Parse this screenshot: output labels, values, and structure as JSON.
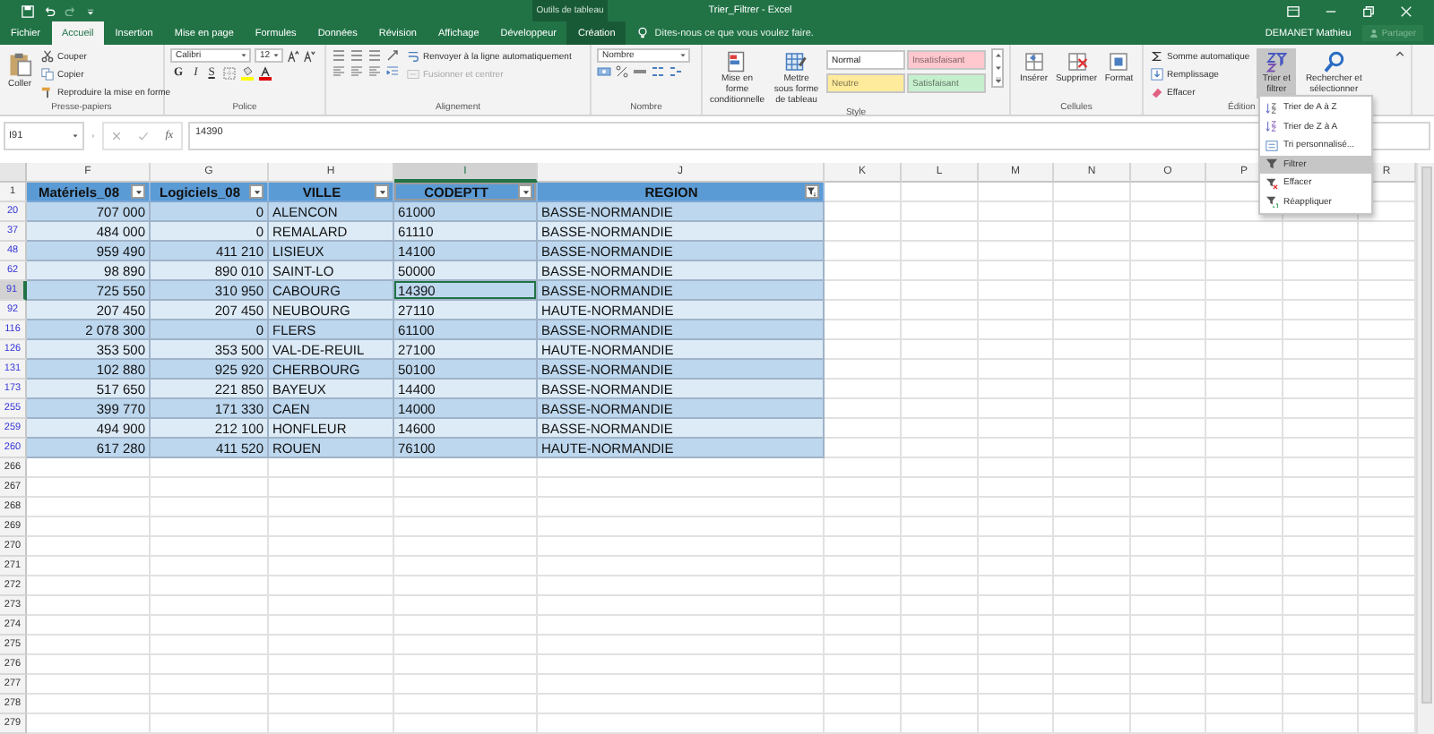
{
  "title_bar": {
    "context_label": "Outils de tableau",
    "title": "Trier_Filtrer - Excel"
  },
  "tabs": [
    {
      "label": "Fichier",
      "selected": false,
      "kind": "file"
    },
    {
      "label": "Accueil",
      "selected": true,
      "kind": "normal"
    },
    {
      "label": "Insertion",
      "selected": false,
      "kind": "normal"
    },
    {
      "label": "Mise en page",
      "selected": false,
      "kind": "normal"
    },
    {
      "label": "Formules",
      "selected": false,
      "kind": "normal"
    },
    {
      "label": "Données",
      "selected": false,
      "kind": "normal"
    },
    {
      "label": "Révision",
      "selected": false,
      "kind": "normal"
    },
    {
      "label": "Affichage",
      "selected": false,
      "kind": "normal"
    },
    {
      "label": "Développeur",
      "selected": false,
      "kind": "normal"
    },
    {
      "label": "Création",
      "selected": false,
      "kind": "context"
    }
  ],
  "tell_me": "Dites-nous ce que vous voulez faire.",
  "user": "DEMANET Mathieu",
  "share": "Partager",
  "ribbon": [
    {
      "kind": "clipboard",
      "label": "Presse-papiers",
      "big": "Coller",
      "items": [
        "Couper",
        "Copier",
        "Reproduire la mise en forme"
      ]
    },
    {
      "kind": "font",
      "label": "Police",
      "font": "Calibri",
      "size": "12",
      "styles": [
        "G",
        "I",
        "S"
      ]
    },
    {
      "kind": "alignment",
      "label": "Alignement",
      "items": [
        {
          "label": "Renvoyer à la ligne automatiquement",
          "disabled": false
        },
        {
          "label": "Fusionner et centrer",
          "disabled": true
        }
      ]
    },
    {
      "kind": "number",
      "label": "Nombre",
      "format": "Nombre"
    },
    {
      "kind": "styles",
      "label": "Style",
      "buttons": [
        "Mise en forme conditionnelle",
        "Mettre sous forme de tableau"
      ],
      "cell_styles": [
        {
          "label": "Normal",
          "color": "#ffffff"
        },
        {
          "label": "Insatisfaisant",
          "color": "#ffc7ce"
        },
        {
          "label": "Neutre",
          "color": "#ffeb9c"
        },
        {
          "label": "Satisfaisant",
          "color": "#c6efce"
        }
      ]
    },
    {
      "kind": "cells",
      "label": "Cellules",
      "buttons": [
        "Insérer",
        "Supprimer",
        "Format"
      ]
    },
    {
      "kind": "editing",
      "label": "Édition",
      "items": [
        "Somme automatique",
        "Remplissage",
        "Effacer"
      ],
      "buttons": [
        {
          "label": "Trier et filtrer",
          "selected": true
        },
        {
          "label": "Rechercher et sélectionner",
          "selected": false
        }
      ]
    }
  ],
  "formula_bar": {
    "name_box": "I91",
    "function_label": "fx",
    "value": "14390"
  },
  "sheet": {
    "columns": [
      {
        "letter": "F",
        "selected": false
      },
      {
        "letter": "G",
        "selected": false
      },
      {
        "letter": "H",
        "selected": false
      },
      {
        "letter": "I",
        "selected": true
      },
      {
        "letter": "J",
        "selected": false
      },
      {
        "letter": "K",
        "selected": false
      },
      {
        "letter": "L",
        "selected": false
      },
      {
        "letter": "M",
        "selected": false
      },
      {
        "letter": "N",
        "selected": false
      },
      {
        "letter": "O",
        "selected": false
      },
      {
        "letter": "P",
        "selected": false
      },
      {
        "letter": "R",
        "selected": false
      }
    ],
    "header_row": "1",
    "headers": [
      {
        "label": "Matériels_08",
        "kind": "number",
        "filtered": false
      },
      {
        "label": "Logiciels_08",
        "kind": "number",
        "filtered": false
      },
      {
        "label": "VILLE",
        "kind": "text",
        "filtered": false
      },
      {
        "label": "CODEPTT",
        "kind": "text",
        "filtered": false
      },
      {
        "label": "REGION",
        "kind": "text",
        "filtered": true
      }
    ],
    "rows": [
      {
        "number": "20",
        "filtered": true,
        "selected": false,
        "cells": [
          "707 000",
          "0",
          "ALENCON",
          "61000",
          "BASSE-NORMANDIE"
        ]
      },
      {
        "number": "37",
        "filtered": true,
        "selected": false,
        "cells": [
          "484 000",
          "0",
          "REMALARD",
          "61110",
          "BASSE-NORMANDIE"
        ]
      },
      {
        "number": "48",
        "filtered": true,
        "selected": false,
        "cells": [
          "959 490",
          "411 210",
          "LISIEUX",
          "14100",
          "BASSE-NORMANDIE"
        ]
      },
      {
        "number": "62",
        "filtered": true,
        "selected": false,
        "cells": [
          "98 890",
          "890 010",
          "SAINT-LO",
          "50000",
          "BASSE-NORMANDIE"
        ]
      },
      {
        "number": "91",
        "filtered": true,
        "selected": true,
        "cells": [
          "725 550",
          "310 950",
          "CABOURG",
          "14390",
          "BASSE-NORMANDIE"
        ]
      },
      {
        "number": "92",
        "filtered": true,
        "selected": false,
        "cells": [
          "207 450",
          "207 450",
          "NEUBOURG",
          "27110",
          "HAUTE-NORMANDIE"
        ]
      },
      {
        "number": "116",
        "filtered": true,
        "selected": false,
        "cells": [
          "2 078 300",
          "0",
          "FLERS",
          "61100",
          "BASSE-NORMANDIE"
        ]
      },
      {
        "number": "126",
        "filtered": true,
        "selected": false,
        "cells": [
          "353 500",
          "353 500",
          "VAL-DE-REUIL",
          "27100",
          "HAUTE-NORMANDIE"
        ]
      },
      {
        "number": "131",
        "filtered": true,
        "selected": false,
        "cells": [
          "102 880",
          "925 920",
          "CHERBOURG",
          "50100",
          "BASSE-NORMANDIE"
        ]
      },
      {
        "number": "173",
        "filtered": true,
        "selected": false,
        "cells": [
          "517 650",
          "221 850",
          "BAYEUX",
          "14400",
          "BASSE-NORMANDIE"
        ]
      },
      {
        "number": "255",
        "filtered": true,
        "selected": false,
        "cells": [
          "399 770",
          "171 330",
          "CAEN",
          "14000",
          "BASSE-NORMANDIE"
        ]
      },
      {
        "number": "259",
        "filtered": true,
        "selected": false,
        "cells": [
          "494 900",
          "212 100",
          "HONFLEUR",
          "14600",
          "BASSE-NORMANDIE"
        ]
      },
      {
        "number": "260",
        "filtered": true,
        "selected": false,
        "cells": [
          "617 280",
          "411 520",
          "ROUEN",
          "76100",
          "HAUTE-NORMANDIE"
        ]
      }
    ],
    "empty_rows": [
      "266",
      "267",
      "268",
      "269",
      "270",
      "271",
      "272",
      "273",
      "274",
      "275",
      "276",
      "277",
      "278",
      "279"
    ]
  },
  "menu": {
    "items": [
      {
        "label": "Trier de A à Z",
        "kind": "sort-asc",
        "selected": false
      },
      {
        "label": "Trier de Z à A",
        "kind": "sort-desc",
        "selected": false
      },
      {
        "label": "Tri personnalisé...",
        "kind": "custom",
        "selected": false
      },
      {
        "label": "Filtrer",
        "kind": "filter",
        "selected": true
      },
      {
        "label": "Effacer",
        "kind": "clear",
        "selected": false
      },
      {
        "label": "Réappliquer",
        "kind": "reapply",
        "selected": false
      }
    ]
  }
}
